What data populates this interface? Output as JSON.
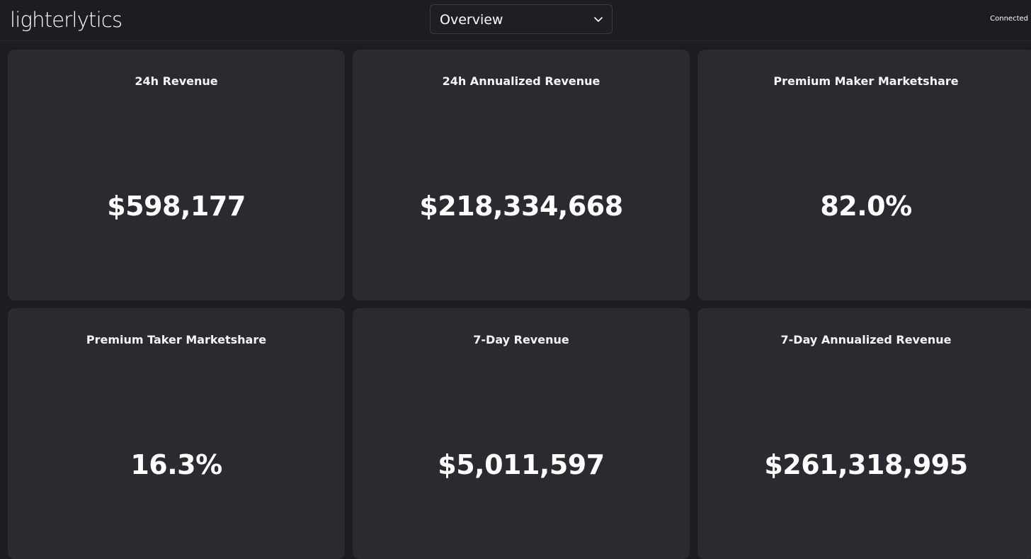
{
  "header": {
    "logo": "lighterlytics",
    "view_select": {
      "selected": "Overview"
    },
    "status": "Connected"
  },
  "metrics": [
    {
      "title": "24h Revenue",
      "value": "$598,177"
    },
    {
      "title": "24h Annualized Revenue",
      "value": "$218,334,668"
    },
    {
      "title": "Premium Maker Marketshare",
      "value": "82.0%"
    },
    {
      "title": "Premium Taker Marketshare",
      "value": "16.3%"
    },
    {
      "title": "7-Day Revenue",
      "value": "$5,011,597"
    },
    {
      "title": "7-Day Annualized Revenue",
      "value": "$261,318,995"
    }
  ],
  "colors": {
    "background": "#1c1d21",
    "card": "#2a2b31",
    "text": "#ffffff"
  }
}
